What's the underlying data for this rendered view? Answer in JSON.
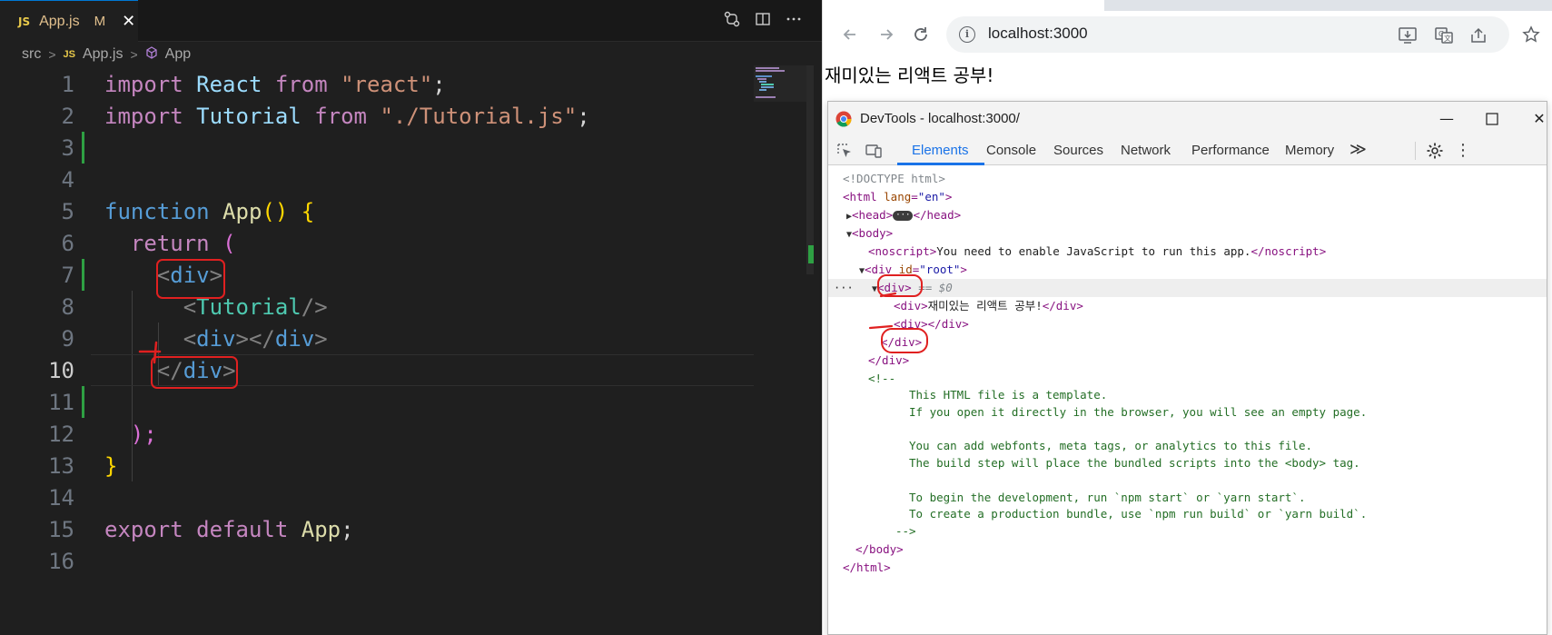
{
  "vscode": {
    "tab": {
      "badge": "JS",
      "filename": "App.js",
      "status": "M",
      "close": "✕"
    },
    "breadcrumb": {
      "folder": "src",
      "badge": "JS",
      "file": "App.js",
      "symbol": "App"
    },
    "lines": [
      {
        "n": "1"
      },
      {
        "n": "2"
      },
      {
        "n": "3"
      },
      {
        "n": "4"
      },
      {
        "n": "5"
      },
      {
        "n": "6"
      },
      {
        "n": "7"
      },
      {
        "n": "8"
      },
      {
        "n": "9"
      },
      {
        "n": "10"
      },
      {
        "n": "11"
      },
      {
        "n": "12"
      },
      {
        "n": "13"
      },
      {
        "n": "14"
      },
      {
        "n": "15"
      },
      {
        "n": "16"
      }
    ],
    "code": {
      "l1": {
        "kw": "import",
        "id": "React",
        "from": "from",
        "str": "\"react\"",
        "end": ";"
      },
      "l2": {
        "kw": "import",
        "id": "Tutorial",
        "from": "from",
        "str": "\"./Tutorial.js\"",
        "end": ";"
      },
      "l5": {
        "kw": "function",
        "fn": "App",
        "rest": "() {"
      },
      "l6": {
        "kw": "return",
        "paren": "("
      },
      "l7": {
        "open": "<",
        "tag": "div",
        "close": ">"
      },
      "l8": {
        "open": "<",
        "tag": "Tutorial",
        "close": "/>"
      },
      "l9": {
        "open": "<",
        "tag": "div",
        "mid": "></",
        "tag2": "div",
        "close": ">"
      },
      "l10": {
        "open": "</",
        "tag": "div",
        "close": ">"
      },
      "l12": {
        "text": ");"
      },
      "l13": {
        "text": "}"
      },
      "l15": {
        "kw1": "export",
        "kw2": "default",
        "id": "App",
        "end": ";"
      }
    }
  },
  "browser": {
    "url": "localhost:3000",
    "page_text": "재미있는 리액트 공부!",
    "devtools": {
      "title": "DevTools - localhost:3000/",
      "tabs": [
        "Elements",
        "Console",
        "Sources",
        "Network",
        "Performance",
        "Memory"
      ],
      "more": "≫",
      "dom": {
        "doctype": "<!DOCTYPE html>",
        "html_open_tag": "<html ",
        "html_attr": "lang",
        "html_eq": "=",
        "html_val": "\"en\"",
        "html_close": ">",
        "head_open": "<head>",
        "head_chip": "···",
        "head_close": "</head>",
        "body_open": "<body>",
        "noscript_open": "<noscript>",
        "noscript_text": "You need to enable JavaScript to run this app.",
        "noscript_close": "</noscript>",
        "root_open": "<div ",
        "root_attr": "id",
        "root_eq": "=",
        "root_val": "\"root\"",
        "root_close": ">",
        "sel_div": "<div>",
        "sel_marker": "== $0",
        "div_text_open": "<div>",
        "div_text": "재미있는 리액트 공부!",
        "div_text_close": "</div>",
        "empty_div_open": "<div>",
        "empty_div_close": "</div>",
        "close_div_inner": "</div>",
        "close_div_outer": "</div>",
        "comment_open": "<!--",
        "comment_1": "This HTML file is a template.",
        "comment_2": "If you open it directly in the browser, you will see an empty page.",
        "comment_3": "You can add webfonts, meta tags, or analytics to this file.",
        "comment_4": "The build step will place the bundled scripts into the <body> tag.",
        "comment_5": "To begin the development, run `npm start` or `yarn start`.",
        "comment_6": "To create a production bundle, use `npm run build` or `yarn build`.",
        "comment_close": "-->",
        "body_close": "</body>",
        "html_close_tag": "</html>",
        "row_dots": "···"
      }
    }
  },
  "colors": {
    "annotation": "#e02020",
    "vscode_bg": "#1f1f1f",
    "devtools_accent": "#1a73e8"
  }
}
